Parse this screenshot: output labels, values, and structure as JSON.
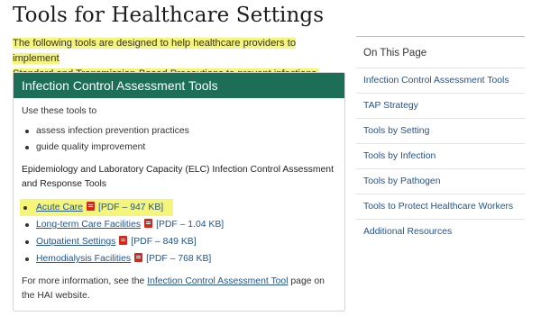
{
  "page": {
    "title": "Tools for Healthcare Settings",
    "intro_line1": "The following tools are designed to help healthcare providers to implement",
    "intro_line2": "Standard and Transmission-Based Precautions to prevent infections."
  },
  "card": {
    "header": "Infection Control Assessment Tools",
    "use_text": "Use these tools to",
    "bullets": [
      "assess infection prevention practices",
      "guide quality improvement"
    ],
    "subhead_line1": "Epidemiology and Laboratory Capacity (ELC) Infection Control Assessment",
    "subhead_line2": "and Response Tools",
    "links": [
      {
        "label": "Acute Care",
        "meta": "[PDF – 947 KB]"
      },
      {
        "label": "Long-term Care Facilities",
        "meta": "[PDF – 1.04 KB]"
      },
      {
        "label": "Outpatient Settings",
        "meta": "[PDF – 849 KB]"
      },
      {
        "label": "Hemodialysis Facilities",
        "meta": "[PDF – 768 KB]"
      }
    ],
    "more_info_prefix": "For more information, see the",
    "more_info_link": "Infection Control Assessment Tool",
    "more_info_suffix": "page on",
    "more_info_line2": "the HAI website."
  },
  "toc": {
    "title": "On This Page",
    "items": [
      "Infection Control Assessment Tools",
      "TAP Strategy",
      "Tools by Setting",
      "Tools by Infection",
      "Tools by Pathogen",
      "Tools to Protect Healthcare Workers",
      "Additional Resources"
    ]
  },
  "colors": {
    "header_bg": "#1c6e57",
    "link": "#205493",
    "highlight": "#f5f57a",
    "pdf_icon": "#d42a1e"
  },
  "icons": {
    "pdf": "pdf-icon"
  }
}
